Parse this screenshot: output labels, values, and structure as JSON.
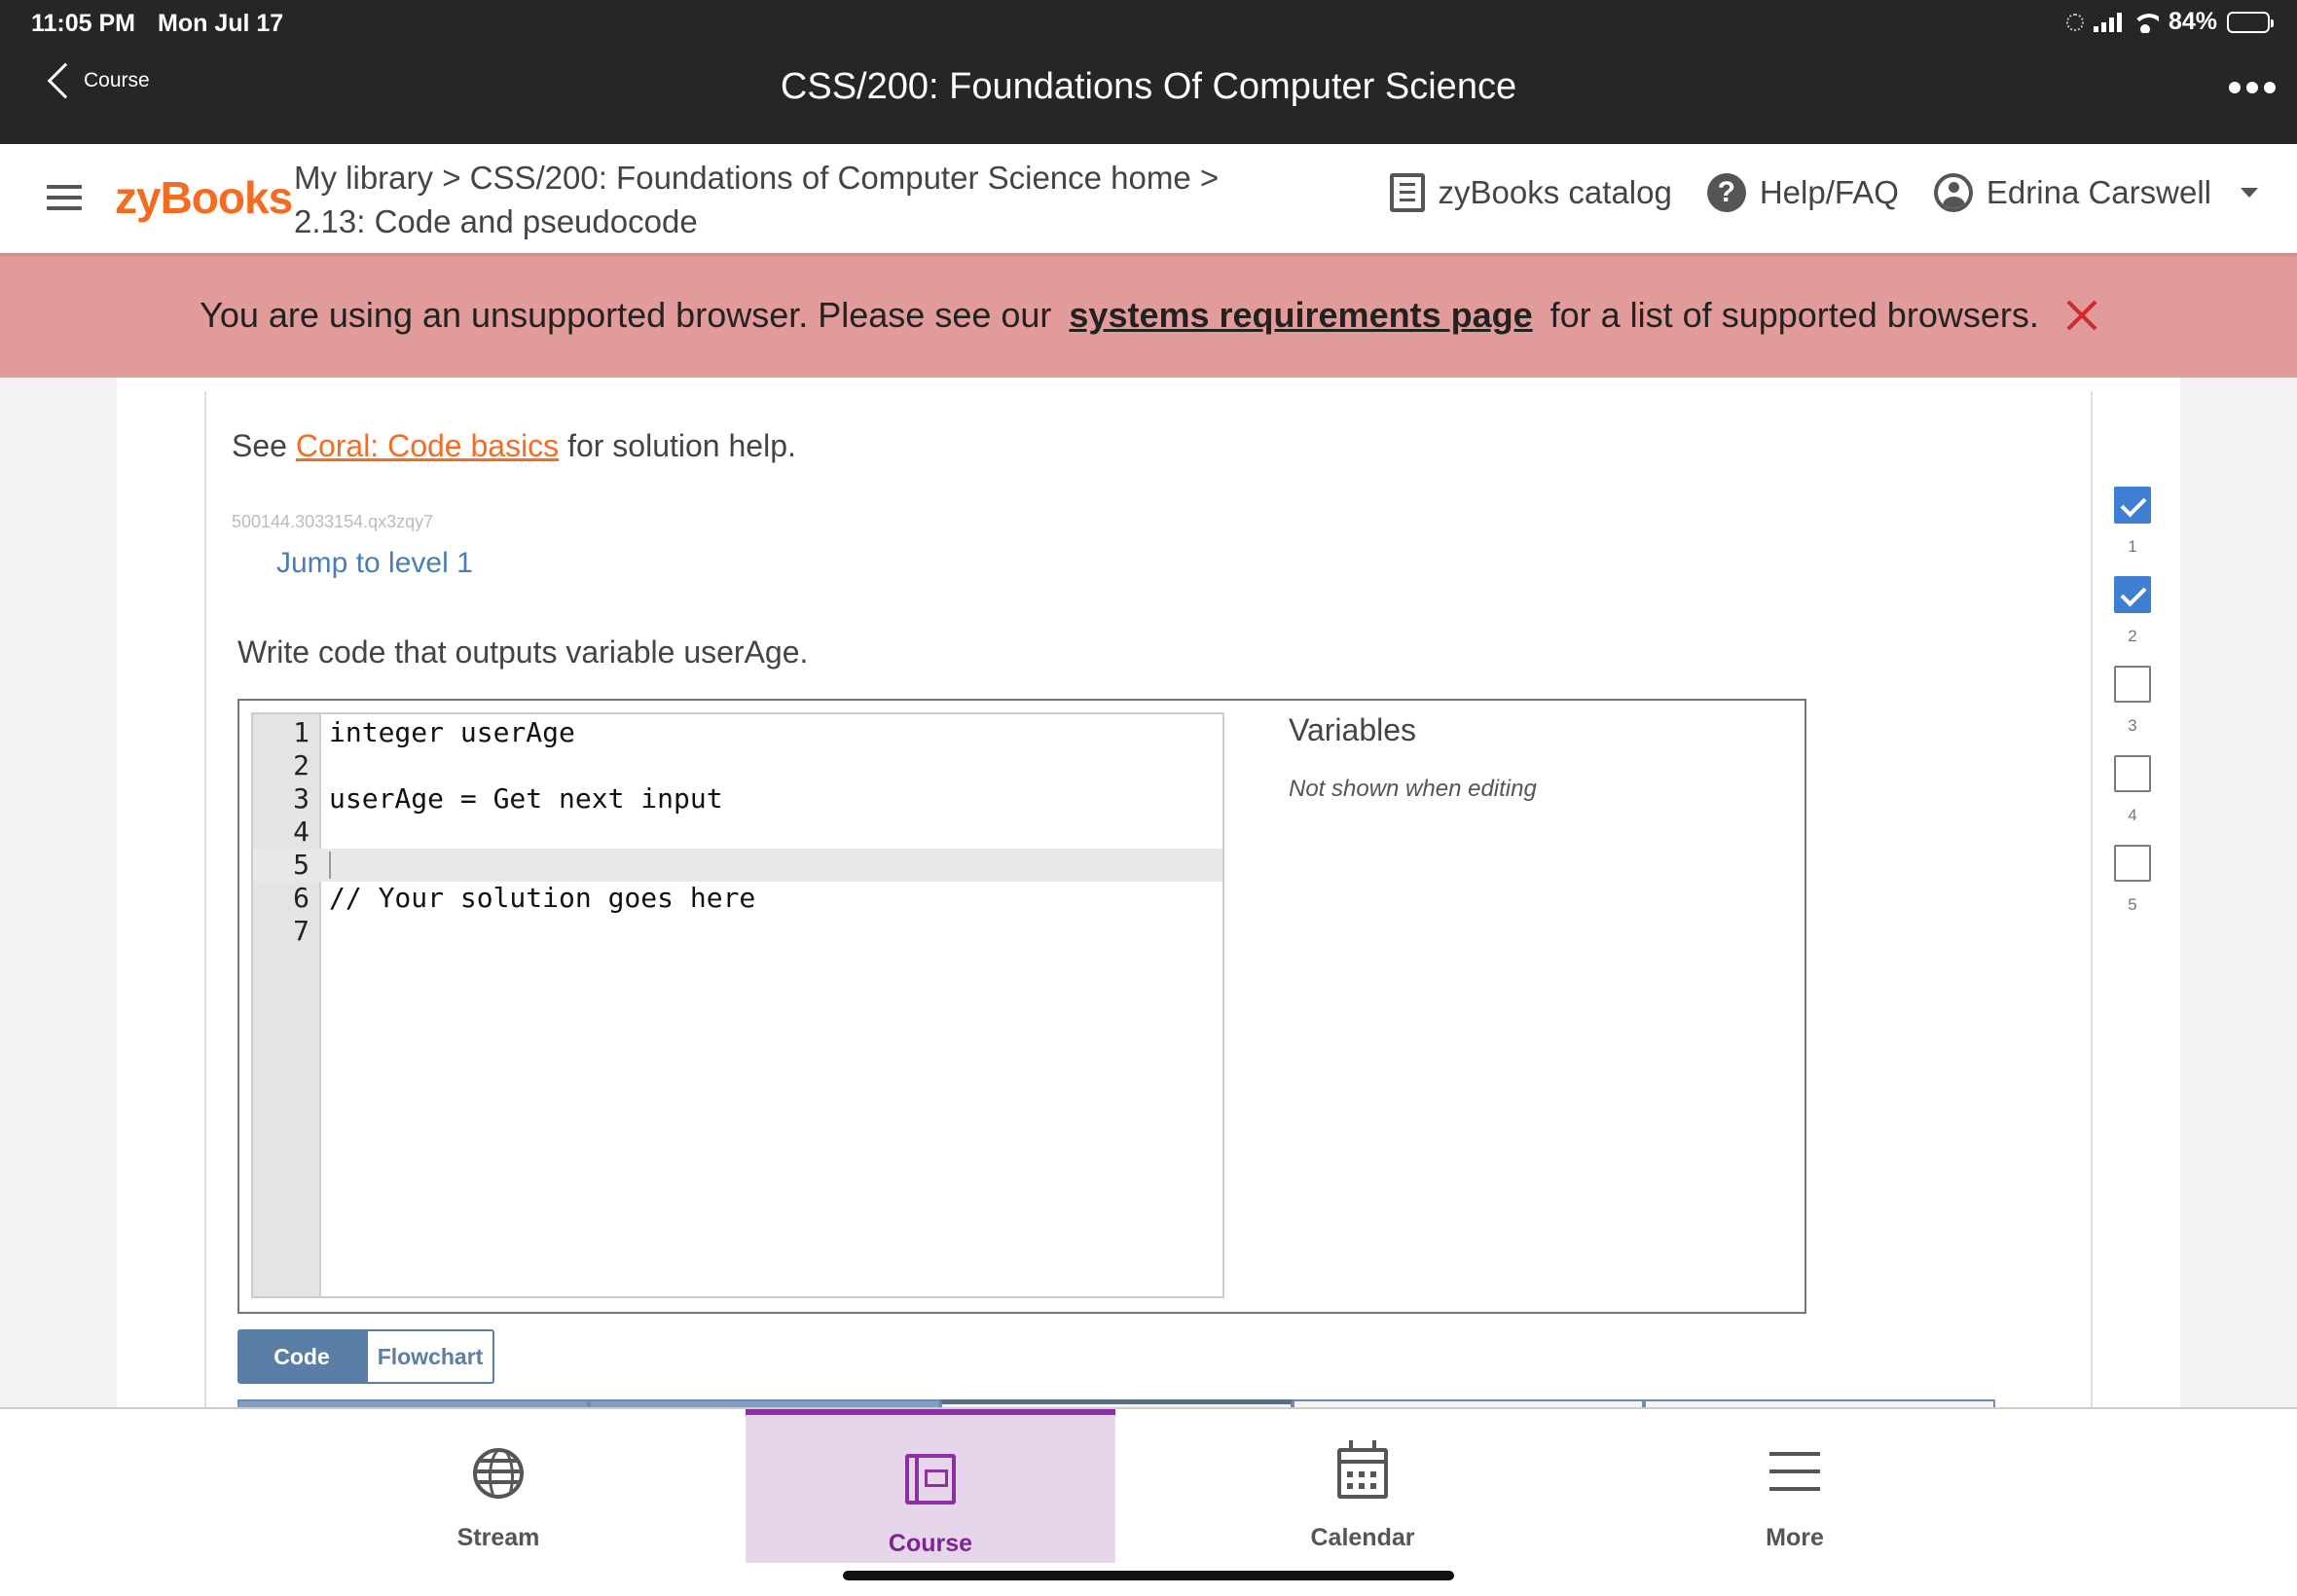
{
  "status": {
    "time": "11:05 PM",
    "date": "Mon Jul 17",
    "battery": "84%",
    "battery_level": 0.84
  },
  "appbar": {
    "back_label": "Course",
    "title": "CSS/200: Foundations Of Computer Science"
  },
  "zybooks": {
    "logo": "zyBooks",
    "crumb_library": "My library",
    "crumb_course": "CSS/200: Foundations of Computer Science home",
    "crumb_sep": ">",
    "crumb_section": "2.13: Code and pseudocode",
    "catalog": "zyBooks catalog",
    "help": "Help/FAQ",
    "user": "Edrina Carswell"
  },
  "banner": {
    "before": "You are using an unsupported browser. Please see our",
    "link": "systems requirements page",
    "after": "for a list of supported browsers."
  },
  "activity": {
    "see": "See",
    "help_link": "Coral: Code basics",
    "help_after": "for solution help.",
    "code_id": "500144.3033154.qx3zqy7",
    "jump": "Jump to level 1",
    "prompt": "Write code that outputs variable userAge.",
    "lines": [
      {
        "n": "1",
        "code": "integer userAge"
      },
      {
        "n": "2",
        "code": ""
      },
      {
        "n": "3",
        "code": "userAge = Get next input"
      },
      {
        "n": "4",
        "code": ""
      },
      {
        "n": "5",
        "code": ""
      },
      {
        "n": "6",
        "code": "// Your solution goes here"
      },
      {
        "n": "7",
        "code": ""
      }
    ],
    "variables_title": "Variables",
    "variables_note": "Not shown when editing",
    "code_btn": "Code",
    "flow_btn": "Flowchart",
    "levels": [
      {
        "num": "1",
        "done": true
      },
      {
        "num": "2",
        "done": true
      },
      {
        "num": "3",
        "done": false
      },
      {
        "num": "4",
        "done": false
      },
      {
        "num": "5",
        "done": false
      }
    ]
  },
  "tabbar": {
    "stream": "Stream",
    "course": "Course",
    "calendar": "Calendar",
    "more": "More"
  }
}
